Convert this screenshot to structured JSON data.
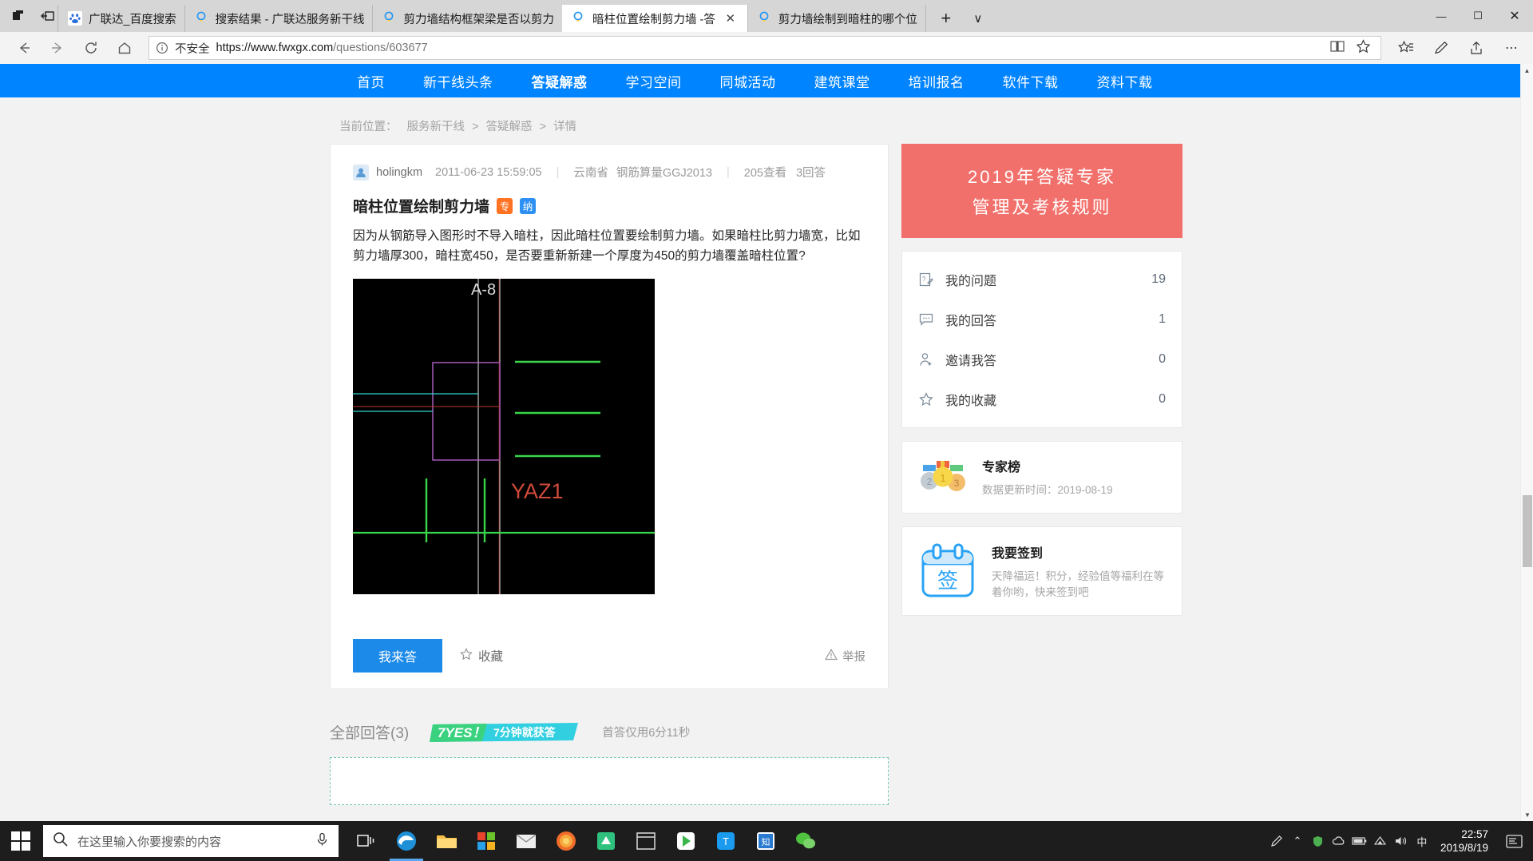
{
  "browser": {
    "tabs": [
      {
        "title": "广联达_百度搜索",
        "favicon": "baidu-icon",
        "active": false
      },
      {
        "title": "搜索结果 - 广联达服务新干线",
        "favicon": "bulb-icon",
        "active": false
      },
      {
        "title": "剪力墙结构框架梁是否以剪力",
        "favicon": "bulb-icon",
        "active": false
      },
      {
        "title": "暗柱位置绘制剪力墙 -答",
        "favicon": "bulb-icon",
        "active": true
      },
      {
        "title": "剪力墙绘制到暗柱的哪个位",
        "favicon": "bulb-icon",
        "active": false
      }
    ],
    "new_tab_label": "+",
    "tab_list_caret": "∨",
    "window_controls": {
      "minimize": "—",
      "maximize": "☐",
      "close": "✕"
    },
    "nav": {
      "back": "←",
      "forward": "→",
      "refresh": "↻",
      "home": "⌂",
      "security_label": "不安全",
      "url_scheme": "https://www.fwxgx.com",
      "url_path": "/questions/603677",
      "reading_view": "book-icon",
      "favorite": "star-icon",
      "favorites_hub": "favorites-icon",
      "notes": "pen-icon",
      "share": "share-icon",
      "settings": "⋯"
    }
  },
  "site": {
    "nav_items": [
      {
        "label": "首页",
        "active": false
      },
      {
        "label": "新干线头条",
        "active": false
      },
      {
        "label": "答疑解惑",
        "active": true
      },
      {
        "label": "学习空间",
        "active": false
      },
      {
        "label": "同城活动",
        "active": false
      },
      {
        "label": "建筑课堂",
        "active": false
      },
      {
        "label": "培训报名",
        "active": false
      },
      {
        "label": "软件下载",
        "active": false
      },
      {
        "label": "资料下载",
        "active": false
      }
    ],
    "breadcrumb": {
      "prefix": "当前位置：",
      "items": [
        "服务新干线",
        "答疑解惑",
        "详情"
      ],
      "separator": ">"
    },
    "accent_color": "#0084ff"
  },
  "question": {
    "author": "holingkm",
    "timestamp": "2011-06-23 15:59:05",
    "province": "云南省",
    "software": "钢筋算量GGJ2013",
    "views": "205查看",
    "answers": "3回答",
    "divider": "|",
    "title": "暗柱位置绘制剪力墙",
    "badges": [
      {
        "text": "专",
        "color": "#ff7221"
      },
      {
        "text": "纳",
        "color": "#2e90f2"
      }
    ],
    "body": "因为从钢筋导入图形时不导入暗柱，因此暗柱位置要绘制剪力墙。如果暗柱比剪力墙宽，比如剪力墙厚300，暗柱宽450，是否要重新新建一个厚度为450的剪力墙覆盖暗柱位置?",
    "image_labels": {
      "top": "A-8",
      "bottom": "YAZ1"
    },
    "actions": {
      "answer_button": "我来答",
      "favorite": "收藏",
      "report": "举报"
    }
  },
  "answers_section": {
    "title": "全部回答(3)",
    "badge_text": "7YES！7分钟就获答",
    "first_answer_note": "首答仅用6分11秒"
  },
  "sidebar": {
    "banner": {
      "line1": "2019年答疑专家",
      "line2": "管理及考核规则",
      "bg": "#f2706b"
    },
    "stats": [
      {
        "icon": "question-note-icon",
        "label": "我的问题",
        "value": "19"
      },
      {
        "icon": "comment-icon",
        "label": "我的回答",
        "value": "1"
      },
      {
        "icon": "user-add-icon",
        "label": "邀请我答",
        "value": "0"
      },
      {
        "icon": "star-outline-icon",
        "label": "我的收藏",
        "value": "0"
      }
    ],
    "expert": {
      "icon": "medals-icon",
      "title": "专家榜",
      "subtitle": "数据更新时间：2019-08-19"
    },
    "checkin": {
      "icon": "calendar-sign-icon",
      "title": "我要签到",
      "subtitle": "天降福运！积分，经验值等福利在等着你哟，快来签到吧"
    }
  },
  "taskbar": {
    "start": "windows-icon",
    "search_placeholder": "在这里输入你要搜索的内容",
    "search_icon": "search-icon",
    "mic_icon": "microphone-icon",
    "apps": [
      {
        "name": "task-view-icon"
      },
      {
        "name": "edge-icon"
      },
      {
        "name": "file-explorer-icon"
      },
      {
        "name": "store-icon"
      },
      {
        "name": "mail-icon"
      },
      {
        "name": "firefox-icon"
      },
      {
        "name": "app-green-icon"
      },
      {
        "name": "app-window-icon"
      },
      {
        "name": "play-store-icon"
      },
      {
        "name": "tim-icon"
      },
      {
        "name": "app-blue-icon"
      },
      {
        "name": "wechat-icon"
      }
    ],
    "tray": {
      "pen_icon": "pen-tray-icon",
      "chevron": "⌃",
      "icons": [
        "shield-green-icon",
        "cloud-icon",
        "battery-icon",
        "network-icon",
        "volume-icon"
      ],
      "ime": "中",
      "time": "22:57",
      "date": "2019/8/19",
      "notifications": "notification-icon"
    }
  }
}
